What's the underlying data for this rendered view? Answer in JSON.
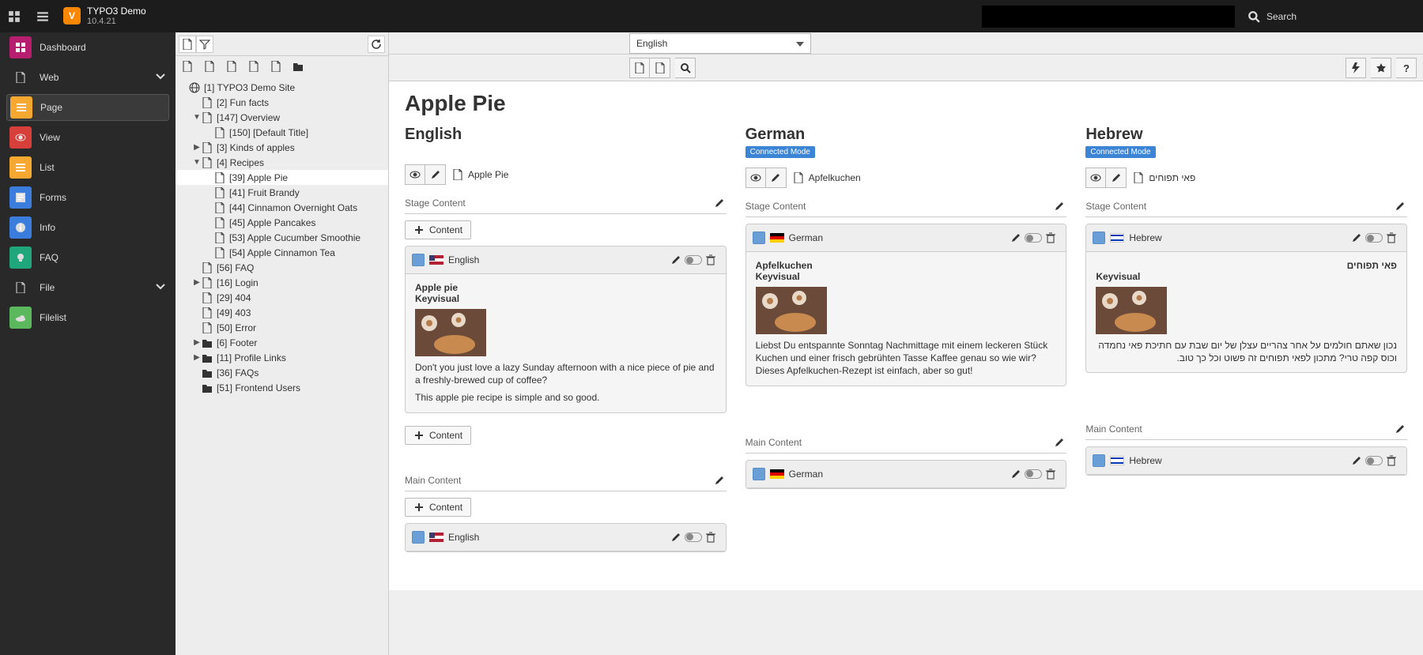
{
  "topbar": {
    "title": "TYPO3 Demo",
    "version": "10.4.21",
    "search_label": "Search"
  },
  "modules": {
    "dashboard": "Dashboard",
    "group_web": "Web",
    "page": "Page",
    "view": "View",
    "list": "List",
    "forms": "Forms",
    "info": "Info",
    "faq": "FAQ",
    "group_file": "File",
    "filelist": "Filelist"
  },
  "tree": {
    "root": "[1] TYPO3 Demo Site",
    "n2": "[2] Fun facts",
    "n147": "[147] Overview",
    "n150": "[150] [Default Title]",
    "n3": "[3] Kinds of apples",
    "n4": "[4] Recipes",
    "n39": "[39] Apple Pie",
    "n41": "[41] Fruit Brandy",
    "n44": "[44] Cinnamon Overnight Oats",
    "n45": "[45] Apple Pancakes",
    "n53": "[53] Apple Cucumber Smoothie",
    "n54": "[54] Apple Cinnamon Tea",
    "n56": "[56] FAQ",
    "n16": "[16] Login",
    "n29": "[29] 404",
    "n49": "[49] 403",
    "n50": "[50] Error",
    "n6": "[6] Footer",
    "n11": "[11] Profile Links",
    "n36": "[36] FAQs",
    "n51": "[51] Frontend Users"
  },
  "doc": {
    "lang_select": "English",
    "h1": "Apple Pie",
    "stage_label": "Stage Content",
    "main_label": "Main Content",
    "add_label": "Content",
    "connected_mode": "Connected Mode",
    "cols": {
      "en": {
        "heading": "English",
        "page_ref": "Apple Pie",
        "ce_lang": "English",
        "ce_title": "Apple pie",
        "ce_sub": "Keyvisual",
        "ce_text_1": "Don't you just love a lazy Sunday afternoon with a nice piece of pie and a freshly-brewed cup of coffee?",
        "ce_text_2": "This apple pie recipe is simple and so good."
      },
      "de": {
        "heading": "German",
        "page_ref": "Apfelkuchen",
        "ce_lang": "German",
        "ce_title": "Apfelkuchen",
        "ce_sub": "Keyvisual",
        "ce_text": "Liebst Du entspannte Sonntag Nachmittage mit einem leckeren Stück Kuchen und einer frisch gebrühten Tasse Kaffee genau so wie wir? Dieses Apfelkuchen-Rezept ist einfach, aber so gut!"
      },
      "he": {
        "heading": "Hebrew",
        "page_ref": "פאי תפוחים",
        "ce_lang": "Hebrew",
        "ce_title": "פאי תפוחים",
        "ce_sub": "Keyvisual",
        "ce_text": "נכון שאתם חולמים על אחר צהריים עצלן של יום שבת עם חתיכת פאי נחמדה וכוס קפה טרי? מתכון לפאי תפוחים זה פשוט וכל כך טוב."
      }
    }
  }
}
